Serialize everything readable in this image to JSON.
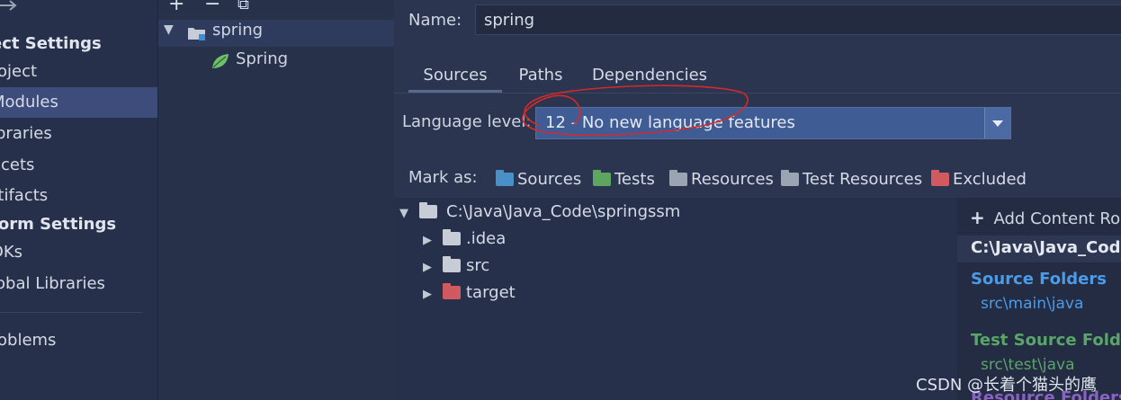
{
  "leftnav": {
    "items": [
      {
        "label": "ect Settings",
        "kind": "head"
      },
      {
        "label": "roject",
        "kind": "item"
      },
      {
        "label": "Modules",
        "kind": "selected"
      },
      {
        "label": "ibraries",
        "kind": "item"
      },
      {
        "label": "acets",
        "kind": "item"
      },
      {
        "label": "rtifacts",
        "kind": "item"
      },
      {
        "label": "form Settings",
        "kind": "head"
      },
      {
        "label": "DKs",
        "kind": "item"
      },
      {
        "label": "lobal Libraries",
        "kind": "item"
      },
      {
        "label": "roblems",
        "kind": "item"
      }
    ]
  },
  "modules": {
    "toolbar": {
      "add": "+",
      "remove": "−",
      "copy": "⧉"
    },
    "tree": [
      {
        "label": "spring",
        "type": "module"
      },
      {
        "label": "Spring",
        "type": "facet"
      }
    ]
  },
  "main": {
    "name_label": "Name:",
    "name_value": "spring",
    "tabs": [
      {
        "label": "Sources"
      },
      {
        "label": "Paths"
      },
      {
        "label": "Dependencies"
      }
    ],
    "language_level_label": "Language level:",
    "language_level_value": "12 - No new language features",
    "mark_as_label": "Mark as:",
    "mark_as": [
      {
        "label": "Sources",
        "color": "#4a90c8"
      },
      {
        "label": "Tests",
        "color": "#5ea55f"
      },
      {
        "label": "Resources",
        "color": "#9aa4b3"
      },
      {
        "label": "Test Resources",
        "color": "#9aa4b3"
      },
      {
        "label": "Excluded",
        "color": "#d05a60"
      }
    ],
    "content_tree": [
      {
        "label": "C:\\Java\\Java_Code\\springssm",
        "level": 0,
        "expanded": true,
        "color": "#c7ccd6"
      },
      {
        "label": ".idea",
        "level": 1,
        "expanded": false,
        "color": "#c7ccd6"
      },
      {
        "label": "src",
        "level": 1,
        "expanded": false,
        "color": "#c7ccd6"
      },
      {
        "label": "target",
        "level": 1,
        "expanded": false,
        "color": "#d05a60"
      }
    ]
  },
  "roots_panel": {
    "add_button": "Add Content Roo",
    "root_path": "C:\\Java\\Java_Code\\",
    "source_folders_title": "Source Folders",
    "source_folder": "src\\main\\java",
    "test_source_folders_title": "Test Source Folder",
    "test_source_folder": "src\\test\\java",
    "resource_folders_title": "Resource Folders"
  },
  "watermark": "CSDN @长着个猫头的鹰",
  "colors": {
    "annotation": "#d42a2a",
    "source": "#4c9be8",
    "test": "#5aa56a",
    "resource": "#8a62c4"
  }
}
